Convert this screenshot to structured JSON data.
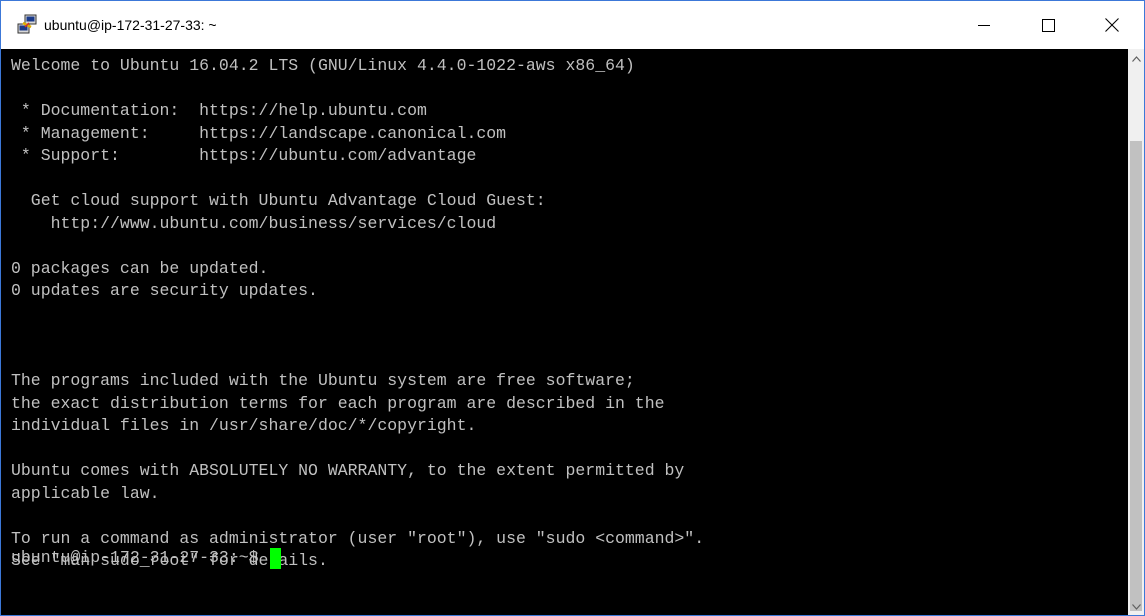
{
  "window": {
    "title": "ubuntu@ip-172-31-27-33: ~",
    "app_icon": "putty-icon"
  },
  "controls": {
    "minimize_icon": "minimize-icon",
    "maximize_icon": "maximize-icon",
    "close_icon": "close-icon"
  },
  "terminal": {
    "lines": [
      "Welcome to Ubuntu 16.04.2 LTS (GNU/Linux 4.4.0-1022-aws x86_64)",
      "",
      " * Documentation:  https://help.ubuntu.com",
      " * Management:     https://landscape.canonical.com",
      " * Support:        https://ubuntu.com/advantage",
      "",
      "  Get cloud support with Ubuntu Advantage Cloud Guest:",
      "    http://www.ubuntu.com/business/services/cloud",
      "",
      "0 packages can be updated.",
      "0 updates are security updates.",
      "",
      "",
      "",
      "The programs included with the Ubuntu system are free software;",
      "the exact distribution terms for each program are described in the",
      "individual files in /usr/share/doc/*/copyright.",
      "",
      "Ubuntu comes with ABSOLUTELY NO WARRANTY, to the extent permitted by",
      "applicable law.",
      "",
      "To run a command as administrator (user \"root\"), use \"sudo <command>\".",
      "See \"man sudo_root\" for details.",
      ""
    ],
    "prompt": "ubuntu@ip-172-31-27-33:~$",
    "cursor_color": "#00ff00",
    "text_color": "#c0c0c0",
    "background_color": "#000000"
  }
}
